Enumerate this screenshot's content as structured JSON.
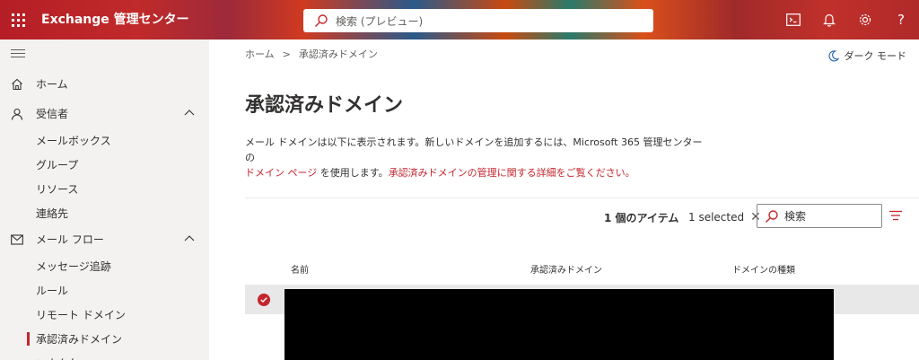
{
  "topbar": {
    "app_title": "Exchange 管理センター",
    "search_placeholder": "検索 (プレビュー)",
    "actions": [
      "terminal-icon",
      "bell-icon",
      "gear-icon",
      "help-icon"
    ],
    "help_label": "?"
  },
  "sidebar": {
    "items": [
      {
        "label": "ホーム",
        "icon": "home-icon"
      },
      {
        "label": "受信者",
        "icon": "person-icon",
        "expanded": true
      },
      {
        "label": "メールボックス"
      },
      {
        "label": "グループ"
      },
      {
        "label": "リソース"
      },
      {
        "label": "連絡先"
      },
      {
        "label": "メール フロー",
        "icon": "mail-icon",
        "expanded": true
      },
      {
        "label": "メッセージ追跡"
      },
      {
        "label": "ルール"
      },
      {
        "label": "リモート ドメイン"
      },
      {
        "label": "承認済みドメイン",
        "active": true
      },
      {
        "label": "コネクタ"
      }
    ]
  },
  "main": {
    "breadcrumb": [
      "ホーム",
      "承認済みドメイン"
    ],
    "breadcrumb_sep": ">",
    "dark_mode": "ダーク モード",
    "title": "承認済みドメイン",
    "desc_line1": "メール ドメインは以下に表示されます。新しいドメインを追加するには、Microsoft 365 管理センターの",
    "desc_link1": "ドメイン ページ",
    "desc_mid": " を使用します。",
    "desc_link2": "承認済みドメインの管理に関する詳細をご覧ください。",
    "item_count": "1 個のアイテム",
    "selected_text": "1 selected",
    "search_placeholder": "検索",
    "columns": [
      "名前",
      "承認済みドメイン",
      "ドメインの種類"
    ]
  },
  "colors": {
    "accent": "#c4262e",
    "sidebar_bg": "#f3f2f1",
    "selected_row": "#e8e8e8"
  }
}
